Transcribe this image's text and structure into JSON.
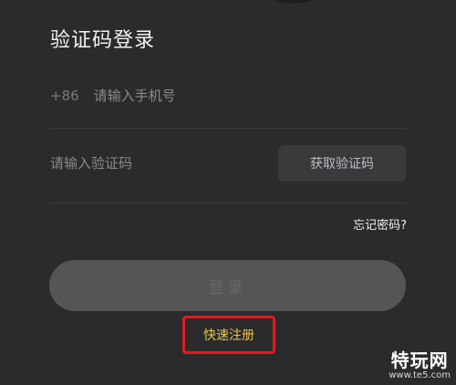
{
  "login": {
    "title": "验证码登录",
    "country_code": "+86",
    "phone_placeholder": "请输入手机号",
    "code_placeholder": "请输入验证码",
    "get_code_label": "获取验证码",
    "forgot_password_label": "忘记密码?",
    "login_button_label": "登录",
    "register_label": "快速注册"
  },
  "watermark": {
    "brand": "特玩网",
    "site": "www.te5.com"
  },
  "colors": {
    "background": "#2b2b2d",
    "register_text": "#e8c24a",
    "highlight_border": "#e21b1b",
    "login_button_bg": "#555558"
  }
}
